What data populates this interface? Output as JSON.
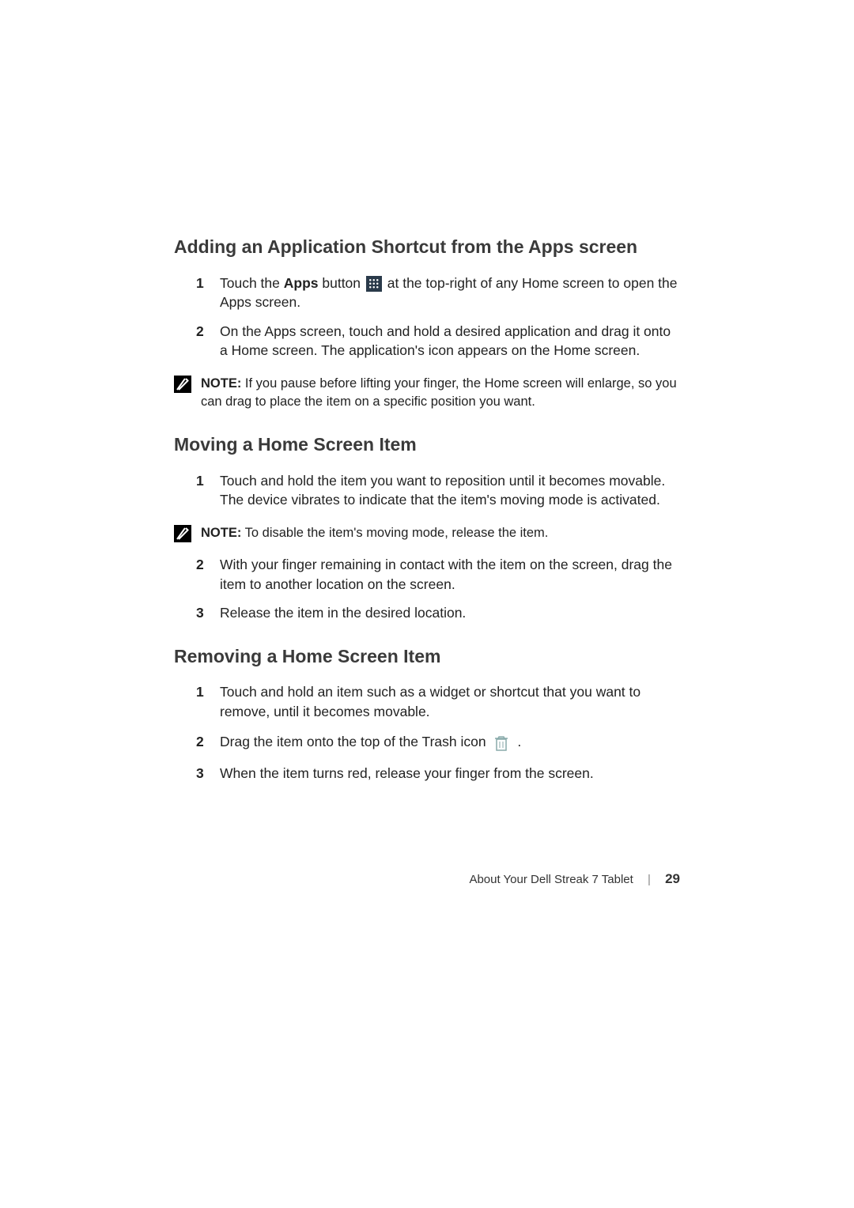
{
  "section1": {
    "heading": "Adding an Application Shortcut from the Apps screen",
    "steps": [
      {
        "num": "1",
        "pre": "Touch the ",
        "bold": "Apps",
        "mid": " button ",
        "icon": "apps",
        "post": " at the top-right of any Home screen to open the Apps screen."
      },
      {
        "num": "2",
        "text": "On the Apps screen, touch and hold a desired application and drag it onto a Home screen. The application's icon appears on the Home screen."
      }
    ],
    "note": {
      "label": "NOTE:",
      "text": " If you pause before lifting your finger, the Home screen will enlarge, so you can drag to place the item on a specific position you want."
    }
  },
  "section2": {
    "heading": "Moving a Home Screen Item",
    "steps_a": [
      {
        "num": "1",
        "text": "Touch and hold the item you want to reposition until it becomes movable. The device vibrates to indicate that the item's moving mode is activated."
      }
    ],
    "note": {
      "label": "NOTE:",
      "text": " To disable the item's moving mode, release the item."
    },
    "steps_b": [
      {
        "num": "2",
        "text": "With your finger remaining in contact with the item on the screen, drag the item to another location on the screen."
      },
      {
        "num": "3",
        "text": "Release the item in the desired location."
      }
    ]
  },
  "section3": {
    "heading": "Removing a Home Screen Item",
    "steps": [
      {
        "num": "1",
        "text": "Touch and hold an item such as a widget or shortcut that you want to remove, until it becomes movable."
      },
      {
        "num": "2",
        "pre": "Drag the item onto the top of the Trash icon ",
        "icon": "trash",
        "post": " ."
      },
      {
        "num": "3",
        "text": "When the item turns red, release your finger from the screen."
      }
    ]
  },
  "footer": {
    "text": "About Your Dell Streak 7 Tablet",
    "page": "29"
  }
}
